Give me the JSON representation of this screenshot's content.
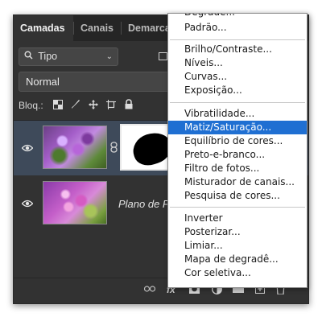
{
  "panel": {
    "tabs": [
      {
        "label": "Camadas",
        "active": true
      },
      {
        "label": "Canais",
        "active": false
      },
      {
        "label": "Demarcad",
        "active": false
      }
    ],
    "filter": {
      "label": "Tipo",
      "icon": "search-icon"
    },
    "blend_mode": "Normal",
    "lock_label": "Bloq.:",
    "layers": [
      {
        "name": "",
        "selected": true,
        "has_mask": true
      },
      {
        "name": "Plano de Fu",
        "selected": false,
        "has_mask": false
      }
    ]
  },
  "menu": {
    "top_cut": "Degradê...",
    "items": [
      "Padrão...",
      "Brilho/Contraste...",
      "Níveis...",
      "Curvas...",
      "Exposição...",
      "Vibratilidade...",
      "Matiz/Saturação...",
      "Equilíbrio de cores...",
      "Preto-e-branco...",
      "Filtro de fotos...",
      "Misturador de canais...",
      "Pesquisa de cores...",
      "Inverter",
      "Posterizar...",
      "Limiar...",
      "Mapa de degradê...",
      "Cor seletiva..."
    ],
    "highlighted": "Matiz/Saturação..."
  },
  "colors": {
    "panel_bg": "#323232",
    "selected_row": "#3e4a5a",
    "menu_highlight": "#1f6fd2"
  }
}
